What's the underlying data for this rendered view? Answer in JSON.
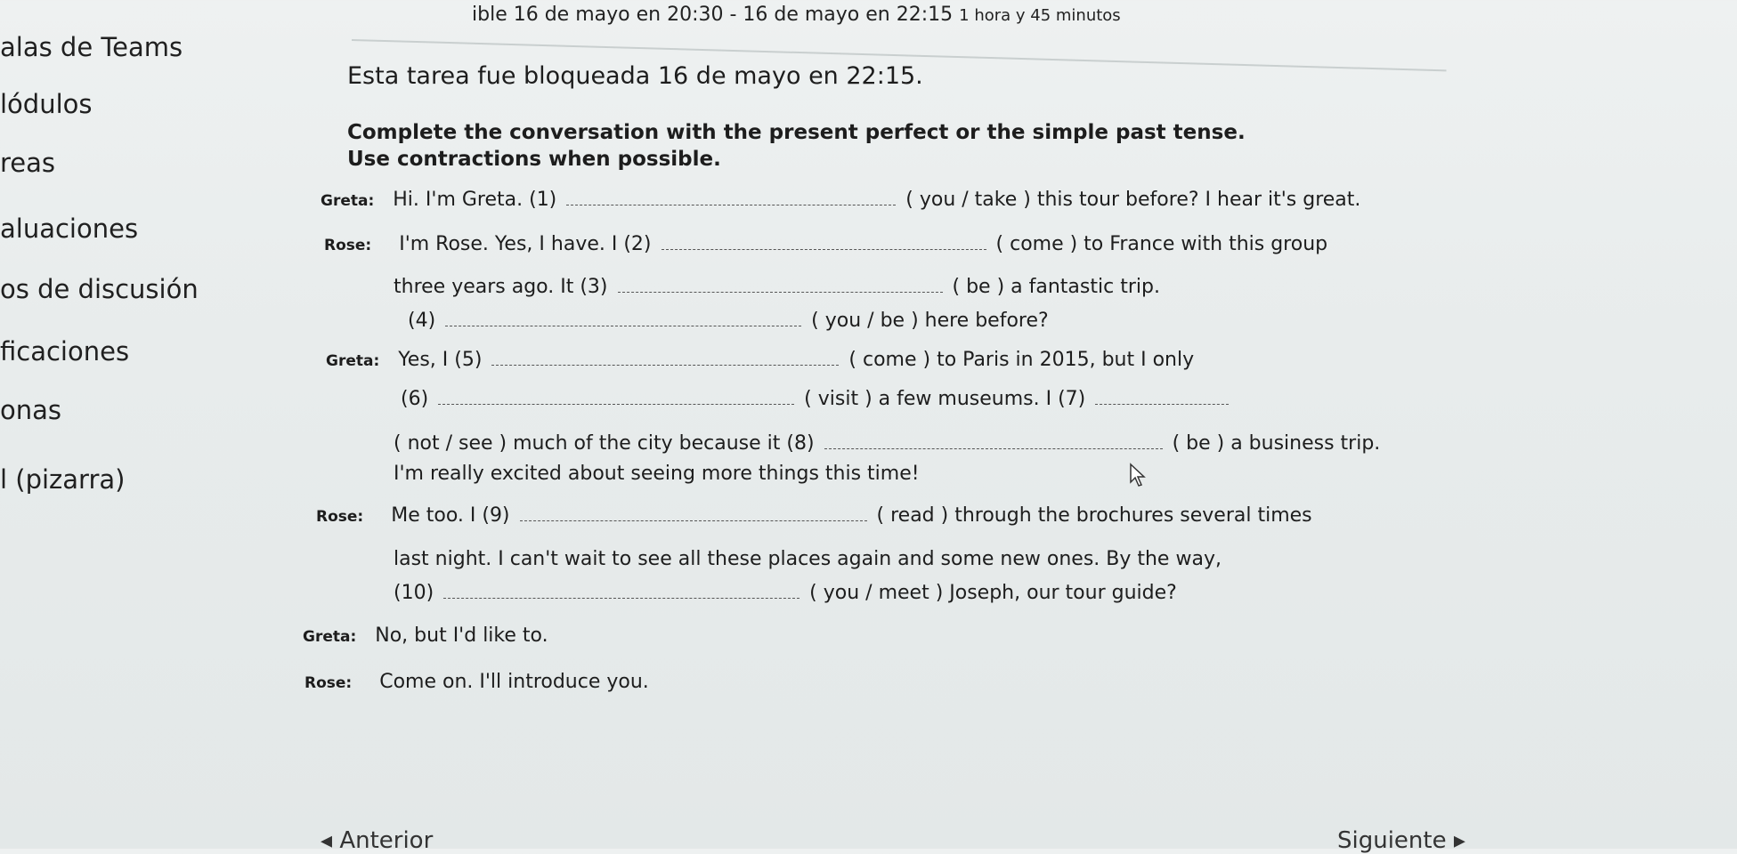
{
  "header": {
    "schedule_prefix": "ible",
    "schedule_main": "16 de mayo en 20:30 - 16 de mayo en 22:15",
    "duration": "1 hora y 45 minutos"
  },
  "sidebar": {
    "items": [
      {
        "label": "alas de Teams"
      },
      {
        "label": "lódulos"
      },
      {
        "label": "reas"
      },
      {
        "label": "aluaciones"
      },
      {
        "label": "os de discusión"
      },
      {
        "label": "ficaciones"
      },
      {
        "label": "onas"
      },
      {
        "label": "l (pizarra)"
      }
    ]
  },
  "notice": "Esta tarea fue bloqueada 16 de mayo en 22:15.",
  "instructions": {
    "line1": "Complete the conversation with the present perfect or the simple past tense.",
    "line2": "Use contractions when possible."
  },
  "dialogue": {
    "l1_speaker": "Greta:",
    "l1_text": "Hi. I'm Greta. (1)",
    "l1_after": "( you  /  take  ) this tour before? I hear it's great.",
    "l2_speaker": "Rose:",
    "l2_text": "I'm Rose. Yes, I have. I (2)",
    "l2_after": "(  come  ) to France with this group",
    "l3_text": "three years ago. It (3)",
    "l3_after": "(  be  ) a fantastic trip.",
    "l4_text": "(4)",
    "l4_after": "(  you  /  be  ) here before?",
    "l5_speaker": "Greta:",
    "l5_text": "Yes, I (5)",
    "l5_after": "(  come  ) to Paris in 2015, but I only",
    "l6_text": "(6)",
    "l6_after": "(  visit  ) a few museums. I (7)",
    "l7_text": "(  not /  see  ) much of the city because it (8)",
    "l7_after": "(  be  ) a business trip.",
    "l8_text": "I'm really excited about seeing more things this time!",
    "l9_speaker": "Rose:",
    "l9_text": "Me too. I (9)",
    "l9_after": "(  read  ) through the brochures several times",
    "l10_text": "last night. I can't wait to see all these places again and some new ones. By the way,",
    "l11_text": "(10)",
    "l11_after": "(  you  /  meet  ) Joseph, our tour guide?",
    "l12_speaker": "Greta:",
    "l12_text": "No, but I'd like to.",
    "l13_speaker": "Rose:",
    "l13_text": "Come on. I'll introduce you."
  },
  "navigation": {
    "prev_label": "◂ Anterior",
    "next_label": "Siguiente ▸"
  }
}
